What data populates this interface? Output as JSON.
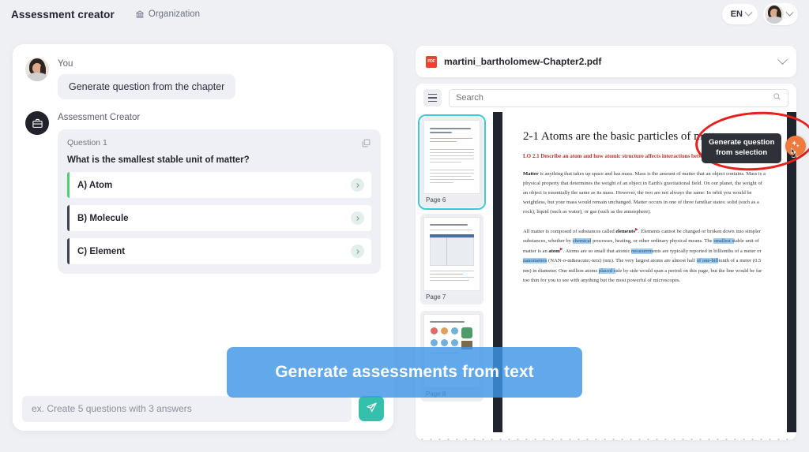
{
  "topbar": {
    "app_title": "Assessment creator",
    "org_label": "Organization",
    "org_icon": "bank-icon",
    "language": "EN",
    "lang_chevron_icon": "chevron-down-icon",
    "user_chevron_icon": "chevron-down-icon",
    "avatar_icon": "user-avatar"
  },
  "chat": {
    "messages": [
      {
        "author": "You",
        "avatar_icon": "user-avatar",
        "text": "Generate question from the chapter"
      },
      {
        "author": "Assessment Creator",
        "avatar_icon": "briefcase-icon"
      }
    ],
    "answer": {
      "question_label": "Question 1",
      "copy_icon": "copy-icon",
      "question_text": "What is the smallest stable unit of matter?",
      "options": [
        {
          "label": "A) Atom",
          "state": "correct",
          "accent": "#4ad36a",
          "chevron_icon": "chevron-right-icon"
        },
        {
          "label": "B) Molecule",
          "state": "normal",
          "accent": "#3c4250",
          "chevron_icon": "chevron-right-icon"
        },
        {
          "label": "C) Element",
          "state": "normal",
          "accent": "#3c4250",
          "chevron_icon": "chevron-right-icon"
        }
      ]
    },
    "composer": {
      "placeholder": "ex. Create 5 questions with 3 answers",
      "value": "",
      "send_icon": "send-icon",
      "send_color": "#35c0ab"
    }
  },
  "pdf": {
    "file_badge": "PDF",
    "file_name": "martini_bartholomew-Chapter2.pdf",
    "collapse_icon": "chevron-down-icon",
    "toolbar": {
      "menu_icon": "hamburger-icon",
      "search_placeholder": "Search",
      "search_value": "",
      "search_icon": "search-icon"
    },
    "thumbnails": [
      {
        "label": "Page 6",
        "active": true
      },
      {
        "label": "Page 7",
        "active": false
      },
      {
        "label": "Page 8",
        "active": false
      }
    ],
    "page": {
      "heading": "2-1 Atoms are the basic particles of matter",
      "learning_objective": "LO 2.1 Describe an atom and how atomic structure affects interactions between atoms.",
      "paragraph_1_lead": "Matter",
      "paragraph_1": " is anything that takes up space and has mass. Mass is the amount of matter that an object contains. Mass is a physical property that determines the weight of an object in Earth's gravitational field. On our planet, the weight of an object is essentially the same as its mass. However, the two are not always the same: In orbit you would be weightless, but your mass would remain unchanged. Matter occurs in one of three familiar states: solid (such as a rock), liquid (such as water), or gas (such as the atmosphere).",
      "paragraph_2_a": "All matter is composed of substances called ",
      "paragraph_2_bold1": "elements",
      "paragraph_2_b": ". Elements cannot be changed or broken down into simpler substances, whether by ",
      "paragraph_2_sel1": "chemical",
      "paragraph_2_c": " processes, heating, or other ordinary physical means. The ",
      "paragraph_2_sel2": "smallest s",
      "paragraph_2_d": "table unit of matter is an ",
      "paragraph_2_bold2": "atom",
      "paragraph_2_e": ". Atoms are so small that atomic ",
      "paragraph_2_sel3": "measurem",
      "paragraph_2_f": "ents are typically reported in billionths of a meter or ",
      "paragraph_2_sel4": "nanometers",
      "paragraph_2_g": " (NAN-o-m&eacute;-terz) (nm). The very largest atoms are almost half ",
      "paragraph_2_sel5": "of one-bill",
      "paragraph_2_h": "ionth of a meter (0.5 nm) in diameter. One million atoms ",
      "paragraph_2_sel6": "placed s",
      "paragraph_2_i": "ide by side would span a period on this page, but the line would be far too thin for you to see with anything but the most powerful of microscopes."
    },
    "generate_tooltip": {
      "line1": "Generate question",
      "line2": "from selection",
      "icon": "sparkle-icon",
      "button_color": "#f07a3c",
      "cursor_icon": "pointer-cursor-icon",
      "annotation_icon": "red-ellipse-annotation",
      "annotation_color": "#e8201c"
    }
  },
  "banner": {
    "text": "Generate assessments from text",
    "color": "#3f96e7"
  }
}
